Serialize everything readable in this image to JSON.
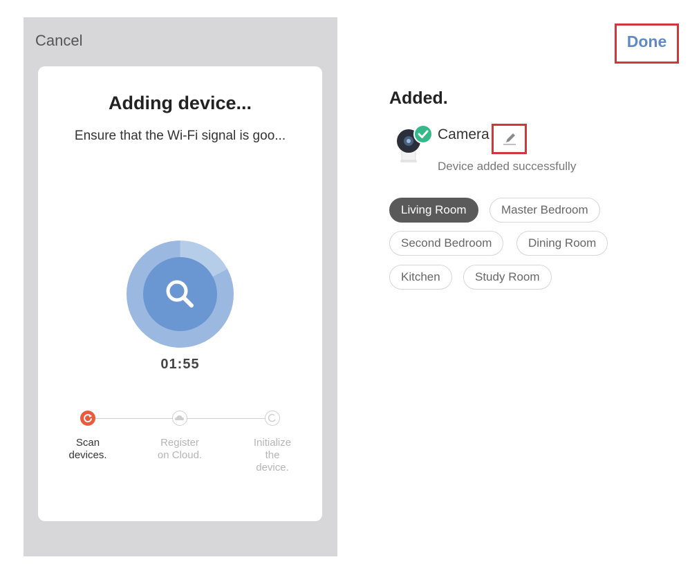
{
  "left_panel": {
    "cancel_label": "Cancel",
    "card": {
      "title": "Adding device...",
      "subtitle": "Ensure that the Wi-Fi signal is goo...",
      "timer": "01:55",
      "steps": [
        {
          "label_line1": "Scan",
          "label_line2": "devices.",
          "label_line3": "",
          "state": "active"
        },
        {
          "label_line1": "Register",
          "label_line2": "on Cloud.",
          "label_line3": "",
          "state": "inactive"
        },
        {
          "label_line1": "Initialize",
          "label_line2": "the",
          "label_line3": "device.",
          "state": "inactive"
        }
      ]
    }
  },
  "right_panel": {
    "done_label": "Done",
    "added_title": "Added.",
    "device": {
      "name": "Camera",
      "status": "Device added successfully",
      "icon": "camera-icon",
      "badge_icon": "check-icon",
      "edit_icon": "pencil-icon"
    },
    "rooms": [
      {
        "label": "Living Room",
        "selected": true
      },
      {
        "label": "Master Bedroom",
        "selected": false
      },
      {
        "label": "Second Bedroom",
        "selected": false
      },
      {
        "label": "Dining Room",
        "selected": false
      },
      {
        "label": "Kitchen",
        "selected": false
      },
      {
        "label": "Study Room",
        "selected": false
      }
    ]
  },
  "colors": {
    "accent_blue": "#5f8ac7",
    "active_step": "#ea5a3b",
    "success_green": "#35b98a",
    "highlight_red": "#d0363b"
  }
}
